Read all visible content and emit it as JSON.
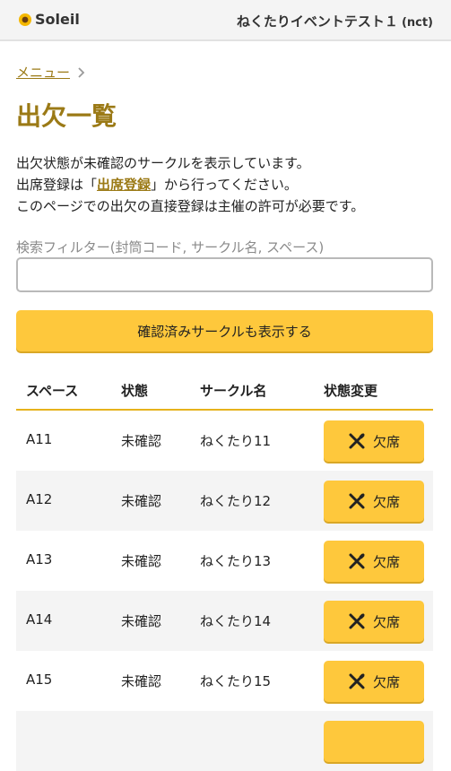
{
  "header": {
    "brand": "Soleil",
    "brand_icon": "sunflower-icon",
    "event_title": "ねくたりイベントテスト１",
    "event_code": "(nct)"
  },
  "breadcrumb": {
    "link": "メニュー",
    "separator_icon": "chevron-right-icon"
  },
  "page_title": "出欠一覧",
  "description": {
    "line1": "出欠状態が未確認のサークルを表示しています。",
    "line2_prefix": "出席登録は「",
    "line2_link": "出席登録",
    "line2_suffix": "」から行ってください。",
    "line3": "このページでの出欠の直接登録は主催の許可が必要です。"
  },
  "filter": {
    "label": "検索フィルター(封筒コード, サークル名, スペース)",
    "value": "",
    "placeholder": ""
  },
  "toggle_button": "確認済みサークルも表示する",
  "table": {
    "headers": {
      "space": "スペース",
      "status": "状態",
      "name": "サークル名",
      "change": "状態変更"
    },
    "rows": [
      {
        "space": "A11",
        "status": "未確認",
        "name": "ねくたり11",
        "action": "欠席"
      },
      {
        "space": "A12",
        "status": "未確認",
        "name": "ねくたり12",
        "action": "欠席"
      },
      {
        "space": "A13",
        "status": "未確認",
        "name": "ねくたり13",
        "action": "欠席"
      },
      {
        "space": "A14",
        "status": "未確認",
        "name": "ねくたり14",
        "action": "欠席"
      },
      {
        "space": "A15",
        "status": "未確認",
        "name": "ねくたり15",
        "action": "欠席"
      }
    ],
    "action_icon": "absent-cross-icon"
  },
  "colors": {
    "accent": "#fec83c",
    "brand_text": "#9b7a16",
    "header_bg": "#f4f4f4"
  }
}
